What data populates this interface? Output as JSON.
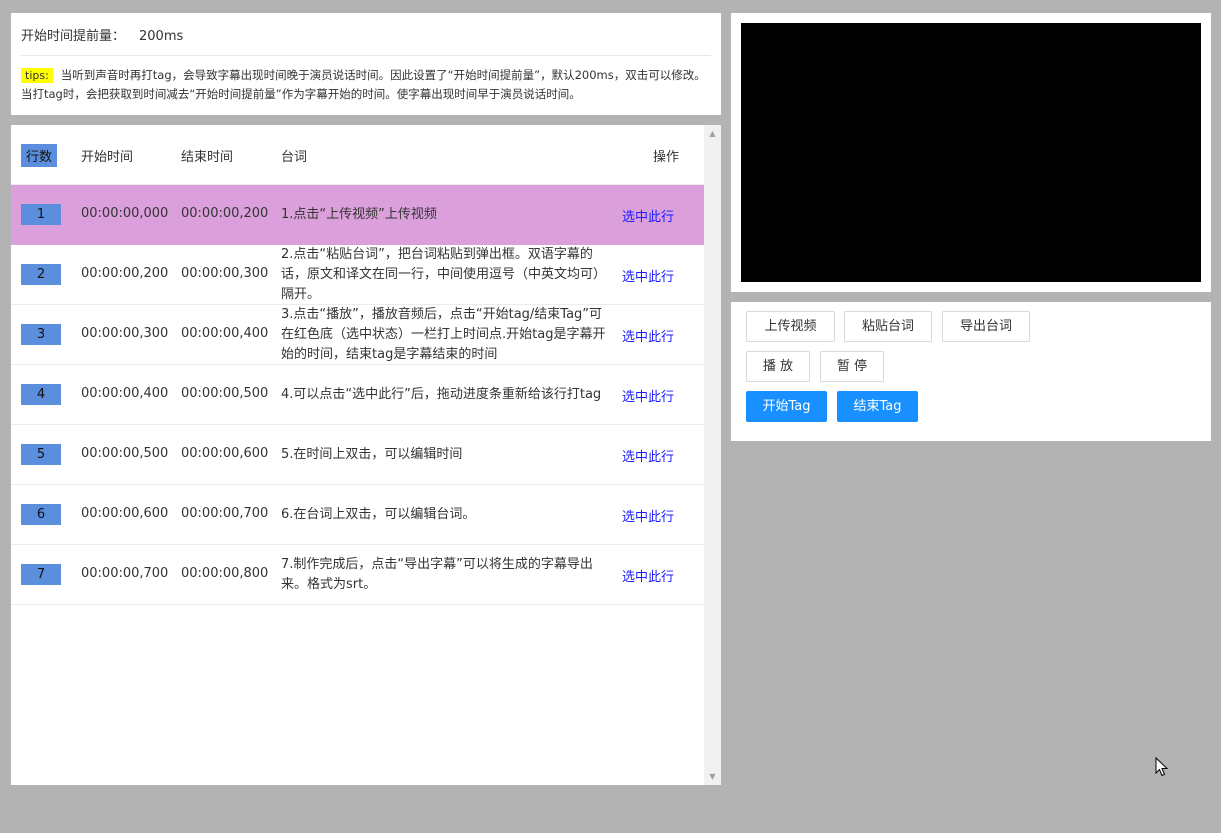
{
  "settings": {
    "offset_label": "开始时间提前量：",
    "offset_value": "200ms",
    "tips_tag": "tips:",
    "tips_text": "当听到声音时再打tag，会导致字幕出现时间晚于演员说话时间。因此设置了“开始时间提前量”，默认200ms，双击可以修改。当打tag时，会把获取到时间减去“开始时间提前量”作为字幕开始的时间。使字幕出现时间早于演员说话时间。"
  },
  "table": {
    "headers": {
      "row_num": "行数",
      "start": "开始时间",
      "end": "结束时间",
      "text": "台词",
      "op": "操作"
    },
    "rows": [
      {
        "num": "1",
        "start": "00:00:00,000",
        "end": "00:00:00,200",
        "text": "1.点击“上传视频”上传视频",
        "op": "选中此行"
      },
      {
        "num": "2",
        "start": "00:00:00,200",
        "end": "00:00:00,300",
        "text": "2.点击“粘贴台词”，把台词粘贴到弹出框。双语字幕的话，原文和译文在同一行，中间使用逗号（中英文均可）隔开。",
        "op": "选中此行"
      },
      {
        "num": "3",
        "start": "00:00:00,300",
        "end": "00:00:00,400",
        "text": "3.点击“播放”，播放音频后，点击“开始tag/结束Tag”可在红色底（选中状态）一栏打上时间点.开始tag是字幕开始的时间，结束tag是字幕结束的时间",
        "op": "选中此行"
      },
      {
        "num": "4",
        "start": "00:00:00,400",
        "end": "00:00:00,500",
        "text": "4.可以点击“选中此行”后，拖动进度条重新给该行打tag",
        "op": "选中此行"
      },
      {
        "num": "5",
        "start": "00:00:00,500",
        "end": "00:00:00,600",
        "text": "5.在时间上双击，可以编辑时间",
        "op": "选中此行"
      },
      {
        "num": "6",
        "start": "00:00:00,600",
        "end": "00:00:00,700",
        "text": "6.在台词上双击，可以编辑台词。",
        "op": "选中此行"
      },
      {
        "num": "7",
        "start": "00:00:00,700",
        "end": "00:00:00,800",
        "text": "7.制作完成后，点击“导出字幕”可以将生成的字幕导出来。格式为srt。",
        "op": "选中此行"
      }
    ]
  },
  "controls": {
    "upload_video": "上传视频",
    "paste_lines": "粘贴台词",
    "export_lines": "导出台词",
    "play": "播 放",
    "pause": "暂 停",
    "start_tag": "开始Tag",
    "end_tag": "结束Tag"
  },
  "colors": {
    "selected_row": "#dba0dc",
    "row_num_bg": "#5b8fdd",
    "primary": "#1890ff",
    "link": "#1a1aff",
    "tips_highlight": "#ffff00"
  }
}
